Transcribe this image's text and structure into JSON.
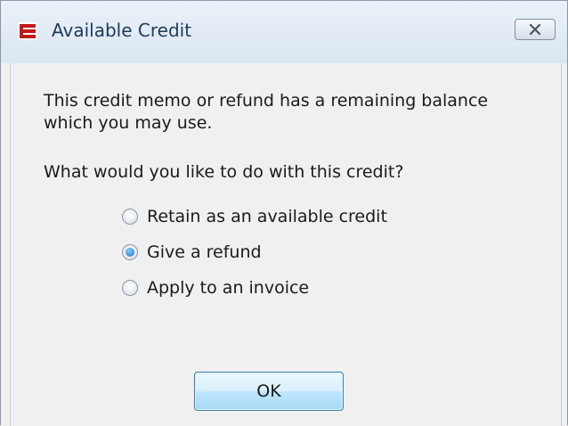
{
  "window": {
    "title": "Available Credit",
    "icon": "app-logo-icon",
    "close_icon": "close-icon"
  },
  "message": {
    "line1": "This credit memo or refund has a remaining balance which you may use.",
    "question": "What would you like to do with this credit?"
  },
  "options": [
    {
      "label": "Retain as an available credit",
      "checked": false
    },
    {
      "label": "Give a refund",
      "checked": true
    },
    {
      "label": "Apply to an invoice",
      "checked": false
    }
  ],
  "buttons": {
    "ok_label": "OK"
  },
  "colors": {
    "title_text": "#1e3a5a",
    "accent": "#1a6fbd",
    "icon_red": "#c41a1a"
  }
}
